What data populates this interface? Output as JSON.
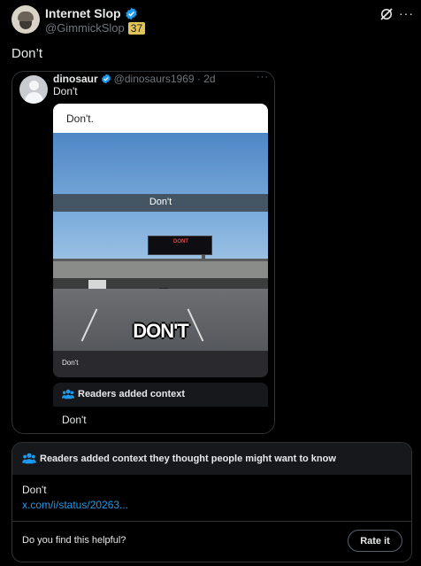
{
  "post": {
    "display_name": "Internet Slop",
    "handle": "@GimmickSlop",
    "handle_badge": "37",
    "text": "Don’t",
    "more_label": "···"
  },
  "quote": {
    "display_name": "dinosaur",
    "handle_time": "@dinosaurs1969 · 2d",
    "more_label": "···",
    "text": "Don't",
    "meme": {
      "top_caption": "Don't.",
      "banner_caption": "Don't",
      "sign_text": "DONT",
      "big_caption": "DON'T",
      "bottom_caption": "Don't"
    },
    "note": {
      "title": "Readers added context",
      "body": "Don't"
    }
  },
  "community_note": {
    "title": "Readers added context they thought people might want to know",
    "body": "Don't",
    "link": "x.com/i/status/20263...",
    "helpful_prompt": "Do you find this helpful?",
    "rate_label": "Rate it"
  },
  "colors": {
    "background": "#000000",
    "text": "#e7e9ea",
    "muted": "#71767b",
    "accent": "#1d9bf0",
    "border": "#2f3336"
  },
  "icons": {
    "verified": "verified-badge-icon",
    "grok": "grok-icon",
    "people": "people-icon"
  }
}
